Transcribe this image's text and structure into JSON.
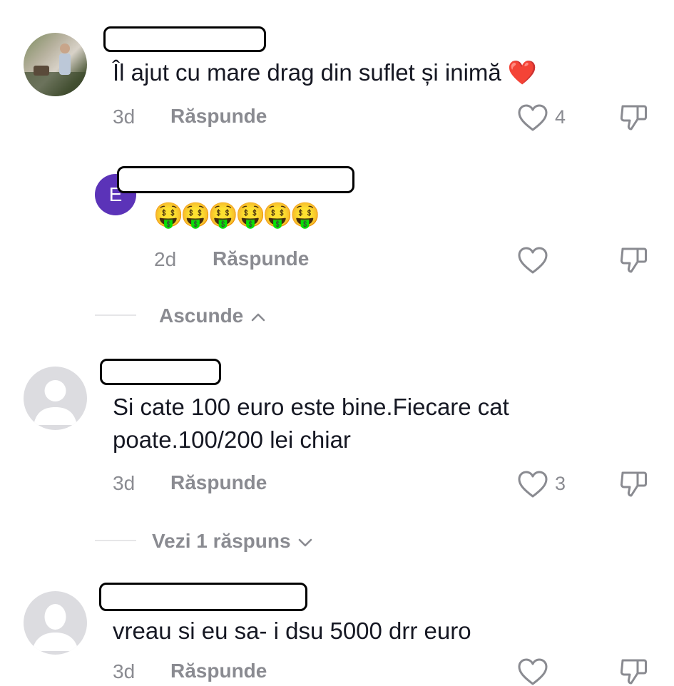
{
  "comments": [
    {
      "text": "Îl ajut cu mare drag din suflet și inimă",
      "emoji": "❤️",
      "time": "3d",
      "reply_label": "Răspunde",
      "likes": "4"
    },
    {
      "avatar_initial": "E",
      "avatar_color": "#5b33b8",
      "text": "🤑🤑🤑🤑🤑🤑",
      "time": "2d",
      "reply_label": "Răspunde",
      "likes": ""
    },
    {
      "text_line1": "Si cate 100 euro este bine.Fiecare cat",
      "text_line2": "poate.100/200 lei chiar",
      "time": "3d",
      "reply_label": "Răspunde",
      "likes": "3"
    },
    {
      "text": "vreau si eu sa- i dsu 5000 drr euro",
      "time": "3d",
      "reply_label": "Răspunde"
    }
  ],
  "threads": {
    "hide_label": "Ascunde",
    "view_replies_label": "Vezi 1 răspuns"
  },
  "icons": {
    "like": "heart-outline-icon",
    "dislike": "thumbs-down-icon",
    "chevron_up": "chevron-up-icon",
    "chevron_down": "chevron-down-icon"
  }
}
